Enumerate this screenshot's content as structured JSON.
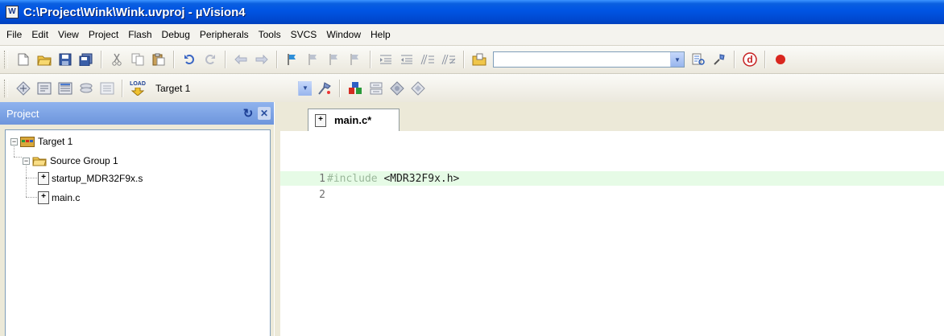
{
  "window": {
    "title": "C:\\Project\\Wink\\Wink.uvproj - µVision4",
    "icon_glyph": "W"
  },
  "menu": [
    "File",
    "Edit",
    "View",
    "Project",
    "Flash",
    "Debug",
    "Peripherals",
    "Tools",
    "SVCS",
    "Window",
    "Help"
  ],
  "toolbar2": {
    "load_label": "LOAD",
    "target_combo": "Target 1"
  },
  "toolbar1": {
    "find_combo": ""
  },
  "project_panel": {
    "title": "Project",
    "tree": {
      "target": "Target 1",
      "group": "Source Group 1",
      "files": [
        "startup_MDR32F9x.s",
        "main.c"
      ]
    }
  },
  "editor": {
    "tab": "main.c*",
    "lines": [
      {
        "number": "1",
        "directive": "#include",
        "argument": " <MDR32F9x.h>"
      },
      {
        "number": "2",
        "directive": "",
        "argument": ""
      }
    ]
  },
  "colors": {
    "titlebar": "#0054e3",
    "current_line": "#e6fbe6",
    "preprocessor": "#9ab79a"
  }
}
